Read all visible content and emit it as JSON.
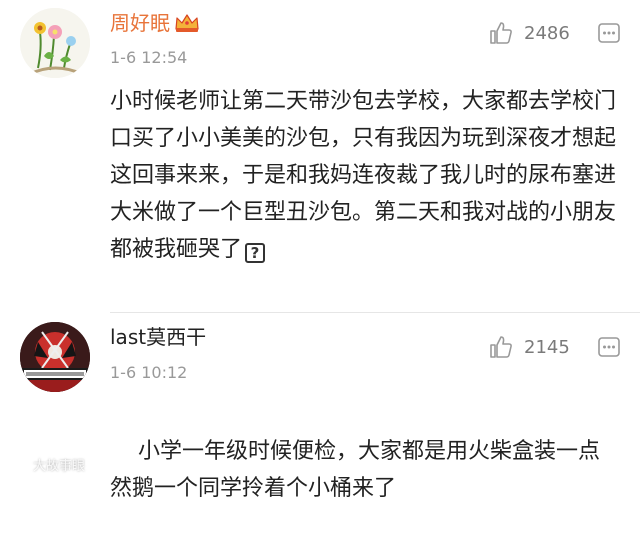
{
  "comments": [
    {
      "username": "周好眠",
      "timestamp": "1-6 12:54",
      "likes": "2486",
      "text_main": "小时候老师让第二天带沙包去学校，大家都去学校门口买了小小美美的沙包，只有我因为玩到深夜才想起这回事来来，于是和我妈连夜裁了我儿时的尿布塞进大米做了一个巨型丑沙包。第二天和我对战的小朋友都被我砸哭了",
      "emoji": "?",
      "badge_icon": "crown-icon",
      "accent_color": "#e8743a"
    },
    {
      "username": "last莫西干",
      "timestamp": "1-6 10:12",
      "likes": "2145",
      "text_main": "小学一年级时候便检，大家都是用火柴盒装一点  然鹅一个同学拎着个小桶来了"
    }
  ],
  "watermark": {
    "text": "大故事眼",
    "icon": "weibo-icon"
  }
}
